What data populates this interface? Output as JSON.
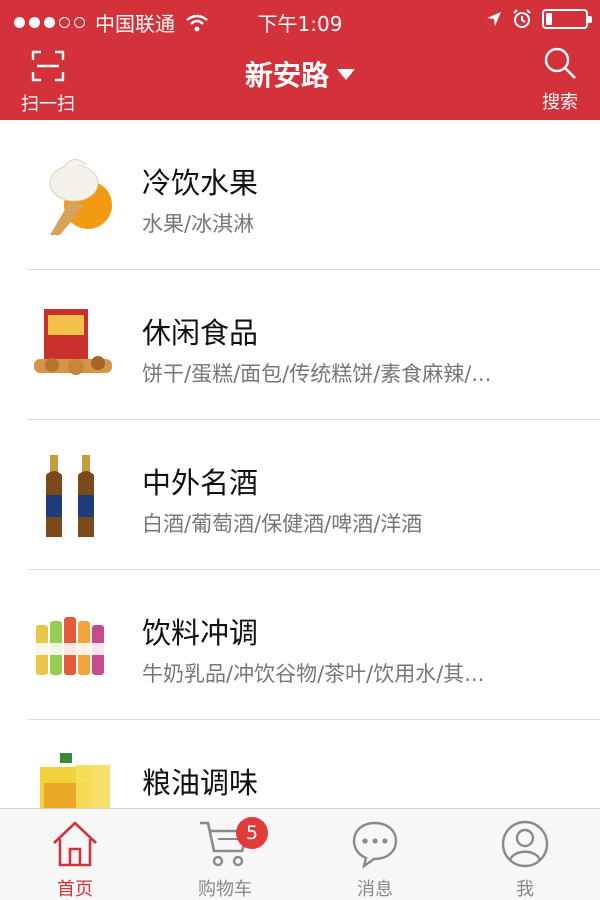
{
  "status_bar": {
    "carrier": "中国联通",
    "time": "下午1:09",
    "signal_bars_filled": 3,
    "signal_bars_total": 5,
    "battery_level": 0.15
  },
  "header": {
    "scan_label": "扫一扫",
    "location": "新安路",
    "search_label": "搜索"
  },
  "categories": [
    {
      "title": "冷饮水果",
      "subtitle": "水果/冰淇淋",
      "icon": "ice-cream-icon"
    },
    {
      "title": "休闲食品",
      "subtitle": "饼干/蛋糕/面包/传统糕饼/素食麻辣/...",
      "icon": "snacks-icon"
    },
    {
      "title": "中外名酒",
      "subtitle": "白酒/葡萄酒/保健酒/啤酒/洋酒",
      "icon": "beer-bottles-icon"
    },
    {
      "title": "饮料冲调",
      "subtitle": "牛奶乳品/冲饮谷物/茶叶/饮用水/其...",
      "icon": "drink-bottles-icon"
    },
    {
      "title": "粮油调味",
      "subtitle": "",
      "icon": "cooking-oil-icon"
    }
  ],
  "tabbar": {
    "tabs": [
      {
        "label": "首页",
        "icon": "home-icon",
        "active": true
      },
      {
        "label": "购物车",
        "icon": "cart-icon",
        "badge": "5"
      },
      {
        "label": "消息",
        "icon": "chat-icon"
      },
      {
        "label": "我",
        "icon": "user-icon"
      }
    ]
  },
  "colors": {
    "brand_red": "#d3323a",
    "badge_red": "#e23b3b"
  }
}
